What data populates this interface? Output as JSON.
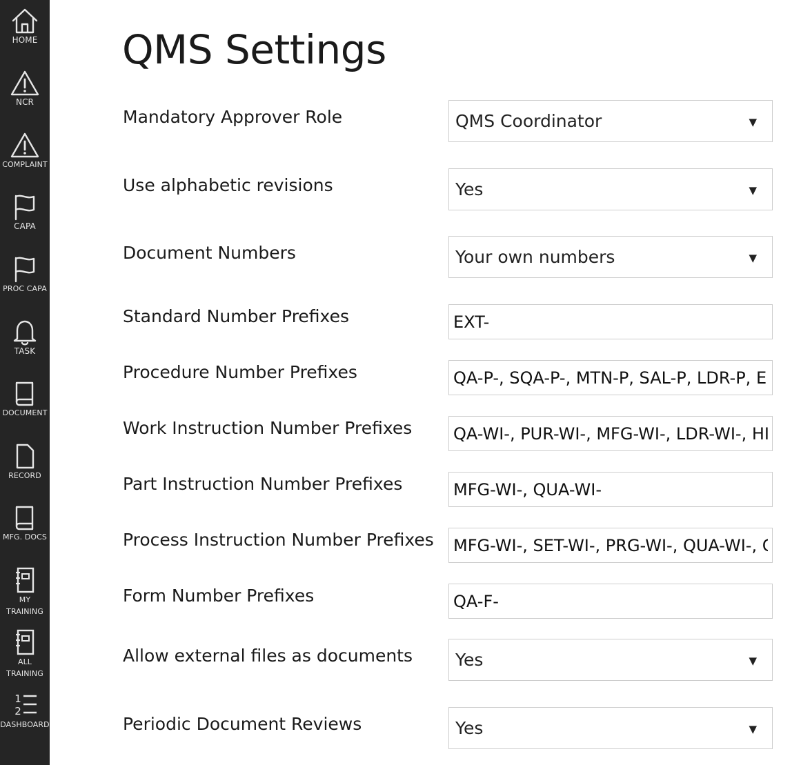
{
  "sidebar": {
    "items": [
      {
        "label": "HOME",
        "icon": "home-icon"
      },
      {
        "label": "NCR",
        "icon": "warning-icon"
      },
      {
        "label": "COMPLAINT",
        "icon": "warning-icon"
      },
      {
        "label": "CAPA",
        "icon": "flag-icon"
      },
      {
        "label": "PROC CAPA",
        "icon": "flag-icon"
      },
      {
        "label": "TASK",
        "icon": "bell-icon"
      },
      {
        "label": "DOCUMENT",
        "icon": "book-icon"
      },
      {
        "label": "RECORD",
        "icon": "file-icon"
      },
      {
        "label": "MFG. DOCS",
        "icon": "book-icon"
      },
      {
        "label_line1": "MY",
        "label_line2": "TRAINING",
        "icon": "notebook-icon"
      },
      {
        "label_line1": "ALL",
        "label_line2": "TRAINING",
        "icon": "notebook-icon"
      },
      {
        "label": "DASHBOARD",
        "icon": "numbered-list-icon"
      }
    ]
  },
  "page": {
    "title": "QMS Settings"
  },
  "settings": [
    {
      "label": "Mandatory Approver Role",
      "type": "select",
      "value": "QMS Coordinator"
    },
    {
      "label": "Use alphabetic revisions",
      "type": "select",
      "value": "Yes"
    },
    {
      "label": "Document Numbers",
      "type": "select",
      "value": "Your own numbers"
    },
    {
      "label": "Standard Number Prefixes",
      "type": "text",
      "value": "EXT-"
    },
    {
      "label": "Procedure Number Prefixes",
      "type": "text",
      "value": "QA-P-, SQA-P-, MTN-P, SAL-P, LDR-P, EI"
    },
    {
      "label": "Work Instruction Number Prefixes",
      "type": "text",
      "value": "QA-WI-, PUR-WI-, MFG-WI-, LDR-WI-, HI"
    },
    {
      "label": "Part Instruction Number Prefixes",
      "type": "text",
      "value": "MFG-WI-, QUA-WI-"
    },
    {
      "label": "Process Instruction Number Prefixes",
      "type": "text",
      "value": "MFG-WI-, SET-WI-, PRG-WI-, QUA-WI-, C"
    },
    {
      "label": "Form Number Prefixes",
      "type": "text",
      "value": "QA-F-"
    },
    {
      "label": "Allow external files as documents",
      "type": "select",
      "value": "Yes"
    },
    {
      "label": "Periodic Document Reviews",
      "type": "select",
      "value": "Yes"
    }
  ],
  "dropdown_arrow": "▼",
  "colors": {
    "sidebar_bg": "#252525",
    "sidebar_text": "#e6e6e6",
    "border": "#cdcdcd"
  }
}
